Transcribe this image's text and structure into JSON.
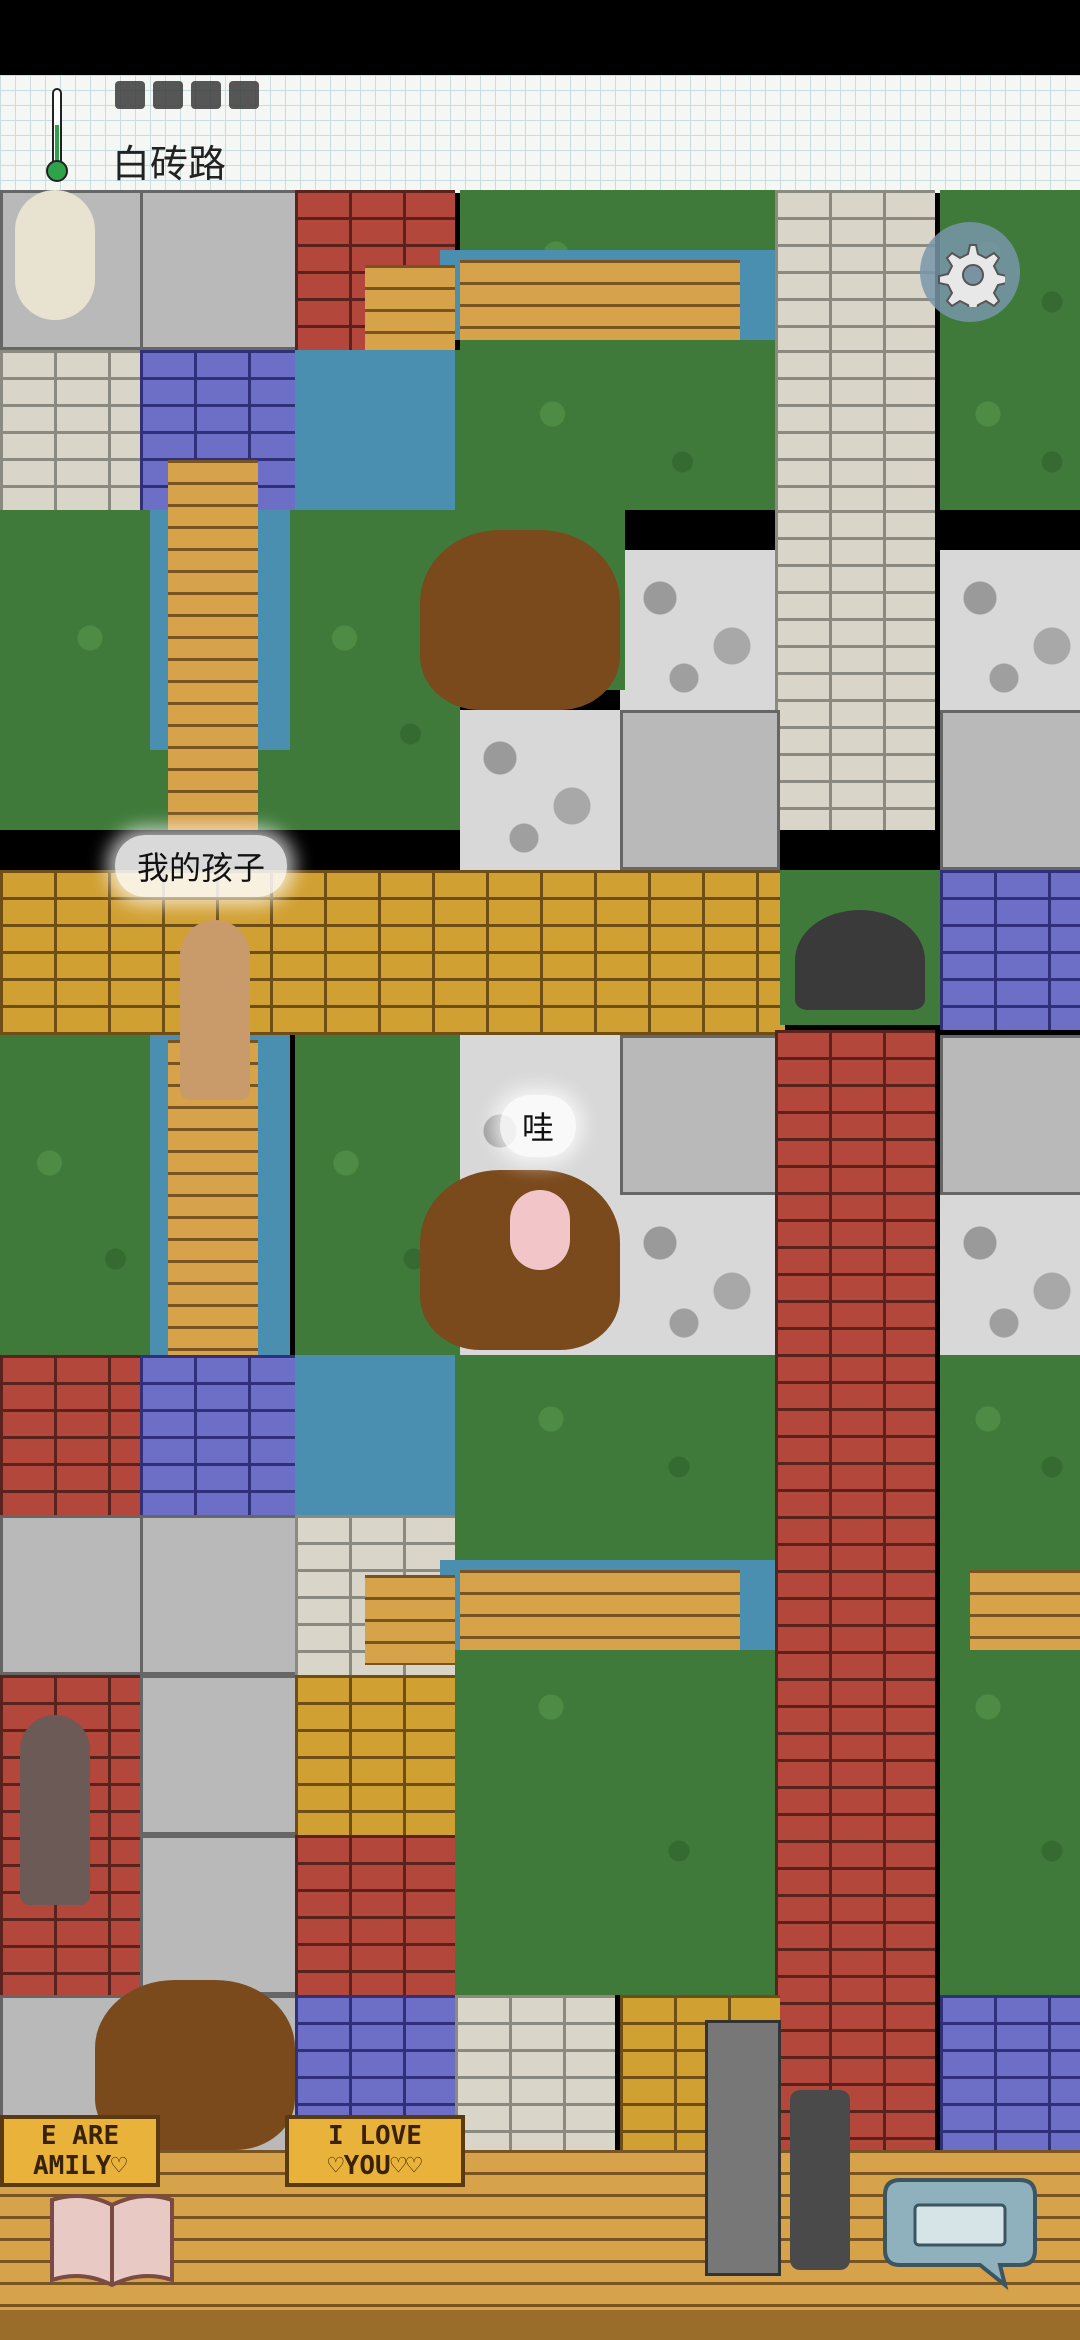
{
  "hud": {
    "current_tile": "白砖路",
    "temperature_icon": "thermometer-icon",
    "hunger_pips": 4
  },
  "speech": {
    "parent_bubble": "我的孩子",
    "baby_bubble": "哇"
  },
  "signs": {
    "left_sign": "E ARE\nAMILY♡",
    "right_sign": "I LOVE\n♡YOU♡♡"
  },
  "buttons": {
    "settings_icon": "gear-icon",
    "book_icon": "book-icon",
    "chat_icon": "keyboard-chat-icon"
  },
  "colors": {
    "hud_bg": "#f4f7f4",
    "grass": "#3f7a3a",
    "red_brick": "#b4473b",
    "blue_brick": "#6d6fc7",
    "yellow_brick": "#d1a032"
  }
}
